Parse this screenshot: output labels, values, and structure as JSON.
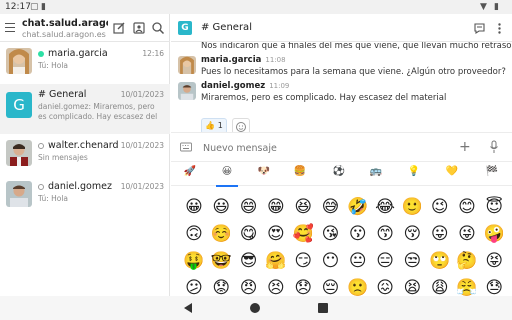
{
  "status_bar": {
    "time": "12:17",
    "icons": [
      "nfc-icon",
      "sim-icon"
    ],
    "right_icons": [
      "wifi-icon",
      "battery-icon"
    ]
  },
  "sidebar": {
    "server_title": "chat.salud.aragon.es",
    "server_subtitle": "chat.salud.aragon.es",
    "rooms": [
      {
        "name": "maria.garcia",
        "date": "12:16",
        "message": "Tú: Hola",
        "status": "online",
        "avatar": "photo"
      },
      {
        "name": "General",
        "date": "10/01/2023",
        "message": "daniel.gomez: Miraremos, pero es complicado. Hay escasez del material",
        "avatar": "G",
        "prefix": "#"
      },
      {
        "name": "walter.chenard",
        "date": "10/01/2023",
        "message": "Sin mensajes",
        "status": "offline",
        "avatar": "photo"
      },
      {
        "name": "daniel.gomez",
        "date": "10/01/2023",
        "message": "Tú: Hola",
        "status": "offline",
        "avatar": "photo"
      }
    ]
  },
  "chat": {
    "title": "# General",
    "badge": "G",
    "messages": [
      {
        "text": "Nos indicaron que a finales del mes que viene, que llevan mucho retraso"
      },
      {
        "author": "maria.garcia",
        "time": "11:08",
        "text": "Pues lo necesitamos para la semana que viene. ¿Algún otro proveedor?"
      },
      {
        "author": "daniel.gomez",
        "time": "11:09",
        "text": "Miraremos, pero es complicado. Hay escasez del material"
      }
    ],
    "reaction": {
      "emoji": "👍",
      "count": "1"
    },
    "composer_placeholder": "Nuevo mensaje"
  },
  "emoji_tabs": [
    "🚀",
    "😀",
    "🐶",
    "🍔",
    "⚽",
    "🚌",
    "💡",
    "💛",
    "🏁"
  ],
  "emoji_rows": [
    [
      "😀",
      "😃",
      "😄",
      "😁",
      "😆",
      "😅",
      "🤣",
      "😂",
      "🙂",
      "😉",
      "😊",
      "😇"
    ],
    [
      "🙃",
      "☺️",
      "😋",
      "😍",
      "🥰",
      "😘",
      "😗",
      "😙",
      "😚",
      "😛",
      "😜",
      "🤪"
    ],
    [
      "🤑",
      "🤓",
      "😎",
      "🤗",
      "😏",
      "😶",
      "😐",
      "😑",
      "😒",
      "🙄",
      "🤔",
      "😝"
    ],
    [
      "😕",
      "😟",
      "😠",
      "😣",
      "😞",
      "😔",
      "🙁",
      "😖",
      "😫",
      "😩",
      "😤",
      "😓"
    ]
  ],
  "colors": {
    "accent": "#1d74f5",
    "online": "#2de0a5",
    "badge": "#2ab7ca"
  }
}
